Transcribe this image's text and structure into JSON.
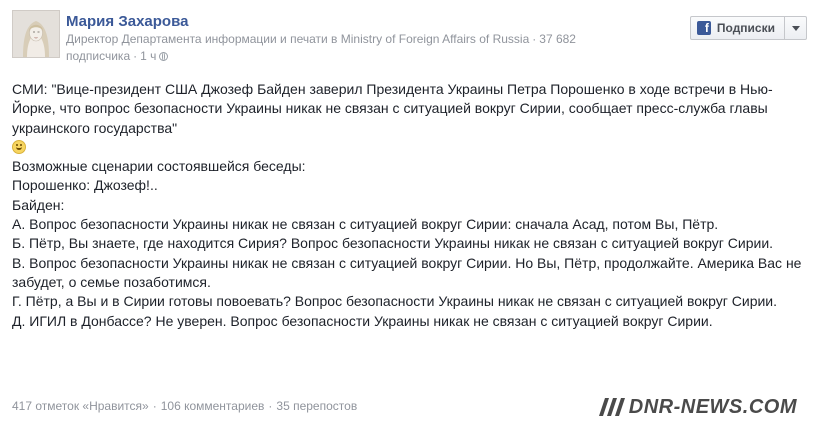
{
  "author": {
    "name": "Мария Захарова",
    "meta_prefix": "Директор Департамента информации и печати в Ministry of Foreign Affairs of Russia",
    "subscribers": "37 682 подписчика",
    "time": "1 ч"
  },
  "subscribe": {
    "icon_letter": "f",
    "label": "Подписки"
  },
  "post": {
    "lines": [
      "СМИ: \"Вице-президент США Джозеф Байден заверил Президента Украины Петра Порошенко в ходе встречи в Нью-Йорке, что вопрос безопасности Украины никак не связан с ситуацией вокруг Сирии, сообщает пресс-служба главы украинского государства\"",
      "Возможные сценарии состоявшейся беседы:",
      "Порошенко: Джозеф!..",
      "Байден:",
      "А. Вопрос безопасности Украины никак не связан с ситуацией вокруг Сирии: сначала Асад, потом Вы, Пётр.",
      "Б. Пётр, Вы знаете, где находится Сирия? Вопрос безопасности Украины никак не связан с ситуацией вокруг Сирии.",
      "В. Вопрос безопасности Украины никак не связан с ситуацией вокруг Сирии. Но Вы, Пётр, продолжайте. Америка Вас не забудет, о семье позаботимся.",
      "Г. Пётр, а Вы и в Сирии готовы повоевать? Вопрос безопасности Украины никак не связан с ситуацией вокруг Сирии.",
      "Д. ИГИЛ в Донбассе? Не уверен. Вопрос безопасности Украины никак не связан с ситуацией вокруг Сирии."
    ],
    "emoji": "laughing-emoji"
  },
  "footer": {
    "likes": "417 отметок «Нравится»",
    "comments": "106 комментариев",
    "shares": "35 перепостов",
    "separator": "·"
  },
  "watermark": {
    "text": "DNR-NEWS.COM"
  },
  "colors": {
    "link": "#3b5998",
    "meta": "#90949c",
    "text": "#1d2129"
  }
}
